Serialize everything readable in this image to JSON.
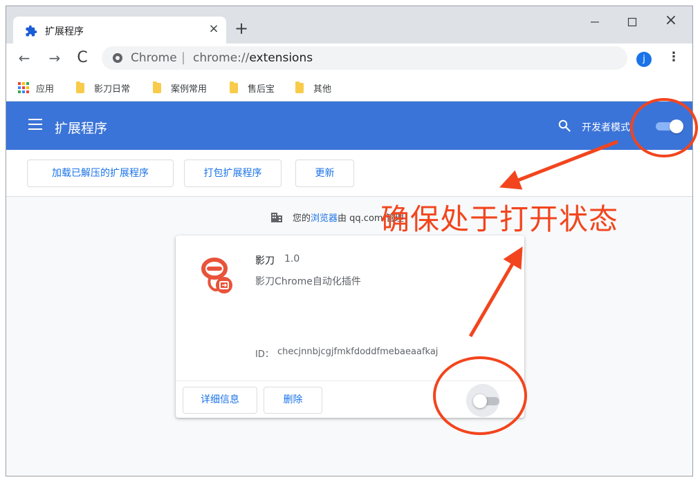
{
  "tab": {
    "title": "扩展程序",
    "close": "×"
  },
  "toolbar": {
    "new_tab": "+",
    "back": "←",
    "forward": "→",
    "reload": "C",
    "omnibox_site": "Chrome",
    "omnibox_separator": "|",
    "omnibox_scheme": "chrome://",
    "omnibox_path": "extensions",
    "star": "☆",
    "avatar_letter": "j",
    "menu": "⋮"
  },
  "window_controls": {
    "close": "×"
  },
  "bookmarks": [
    {
      "label": "应用"
    },
    {
      "label": "影刀日常"
    },
    {
      "label": "案例常用"
    },
    {
      "label": "售后宝"
    },
    {
      "label": "其他"
    }
  ],
  "extensions_header": {
    "title": "扩展程序",
    "developer_mode_label": "开发者模式",
    "developer_mode_on": true
  },
  "actions": {
    "load_unpacked": "加载已解压的扩展程序",
    "pack": "打包扩展程序",
    "update": "更新"
  },
  "managed_notice": {
    "prefix": "您的",
    "link": "浏览器",
    "suffix": "由 qq.com 管理"
  },
  "extension": {
    "name": "影刀",
    "version": "1.0",
    "description": "影刀Chrome自动化插件",
    "id_label": "ID：",
    "id": "checjnnbjcgjfmkfdoddfmebaeaafkaj",
    "details_button": "详细信息",
    "remove_button": "删除",
    "enabled": false
  },
  "annotation": {
    "text": "确保处于打开状态"
  },
  "colors": {
    "header_blue": "#3b74d8",
    "link_blue": "#1a73e8",
    "annotation_red": "#f2451e",
    "logo_red": "#e8533a",
    "folder_yellow": "#f9cb4a"
  }
}
